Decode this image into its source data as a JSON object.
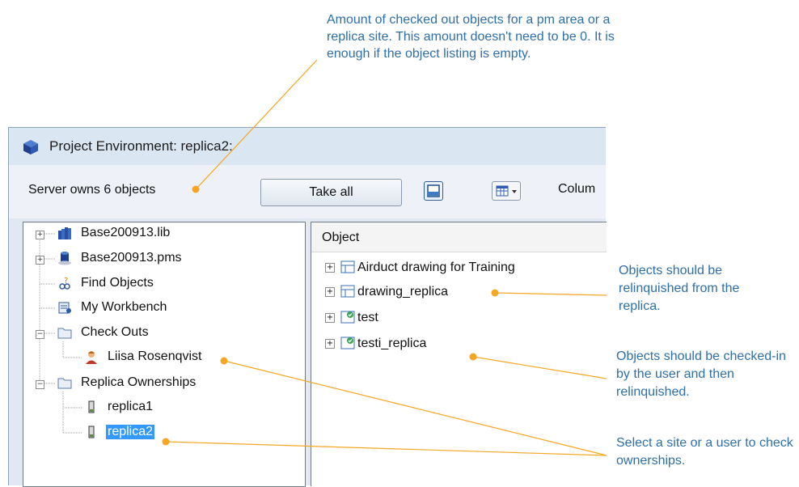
{
  "callouts": {
    "top": "Amount of checked out objects for a pm area or a replica site. This amount doesn't need to be 0. It is enough if the object listing is empty.",
    "relinquish": "Objects should be relinquished from the replica.",
    "checkin": "Objects should be checked-in by the user and then relinquished.",
    "select": "Select a site or a user to check ownerships."
  },
  "window": {
    "title": "Project Environment: replica2:"
  },
  "toolbar": {
    "server_owns": "Server owns 6 objects",
    "take_all": "Take all",
    "columns_label": "Colum"
  },
  "tree": {
    "items": [
      {
        "label": "Base200913.lib",
        "icon": "library-icon"
      },
      {
        "label": "Base200913.pms",
        "icon": "database-icon"
      },
      {
        "label": "Find Objects",
        "icon": "find-objects-icon"
      },
      {
        "label": "My Workbench",
        "icon": "workbench-icon"
      },
      {
        "label": "Check Outs",
        "icon": "folder-icon"
      },
      {
        "label": "Liisa Rosenqvist",
        "icon": "user-icon"
      },
      {
        "label": "Replica Ownerships",
        "icon": "folder-icon"
      },
      {
        "label": "replica1",
        "icon": "replica-icon"
      },
      {
        "label": "replica2",
        "icon": "replica-icon"
      }
    ]
  },
  "list": {
    "header": "Object",
    "rows": [
      {
        "label": "Airduct drawing for Training",
        "icon": "drawing-icon"
      },
      {
        "label": "drawing_replica",
        "icon": "drawing-icon"
      },
      {
        "label": "test",
        "icon": "checked-drawing-icon"
      },
      {
        "label": "testi_replica",
        "icon": "checked-drawing-icon"
      }
    ]
  },
  "colors": {
    "callout_text": "#2e6fa8",
    "callout_line": "#f5a623",
    "selection": "#3399ff"
  }
}
